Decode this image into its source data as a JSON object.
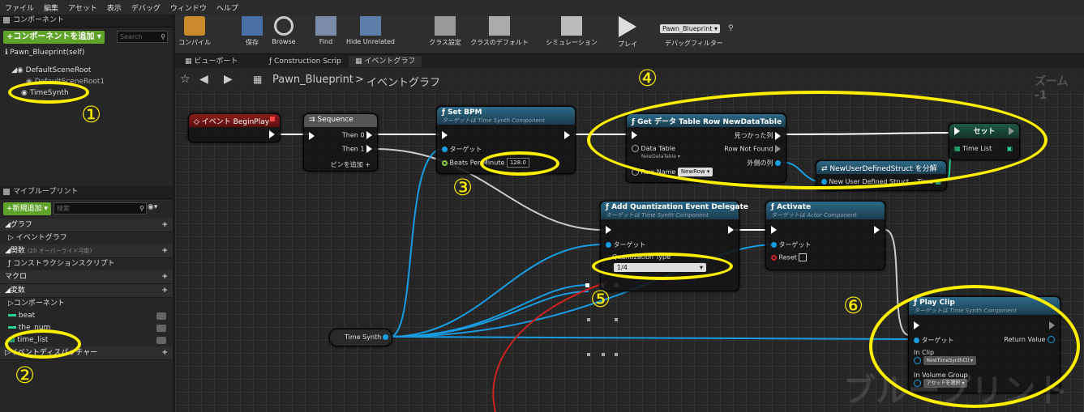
{
  "menu": [
    "ファイル",
    "編集",
    "アセット",
    "表示",
    "デバッグ",
    "ウィンドウ",
    "ヘルプ"
  ],
  "components_panel": {
    "title": "コンポーネント",
    "add_button": "+コンポーネントを追加 ▾",
    "search_placeholder": "Search",
    "self_label": "Pawn_Blueprint(self)",
    "tree": [
      "DefaultSceneRoot",
      "DefaultSceneRoot1",
      "TimeSynth"
    ]
  },
  "mybp_panel": {
    "title": "マイブループリント",
    "add_button": "+新規追加 ▾",
    "search_placeholder": "検索",
    "categories": [
      {
        "label": "グラフ"
      },
      {
        "label": "イベントグラフ",
        "sub": true
      },
      {
        "label": "関数",
        "note": "(20 オーバーライド可能)"
      },
      {
        "label": "コンストラクションスクリプト",
        "sub": true
      },
      {
        "label": "マクロ"
      },
      {
        "label": "変数"
      },
      {
        "label": "コンポーネント",
        "sub": true
      }
    ],
    "variables": [
      "beat",
      "the_num",
      "time_list"
    ],
    "dispatcher_label": "イベントディスパッチャー"
  },
  "toolbar": {
    "buttons": [
      "コンパイル",
      "保存",
      "Browse",
      "Find",
      "Hide Unrelated",
      "クラス設定",
      "クラスのデフォルト",
      "シミュレーション",
      "プレイ"
    ],
    "debug_select": "Pawn_Blueprint ▾",
    "debug_filter_label": "デバッグフィルター"
  },
  "tabs": [
    "ビューポート",
    "Construction Scrip",
    "イベントグラフ"
  ],
  "breadcrumb": {
    "root": "Pawn_Blueprint",
    "sep": ">",
    "page": "イベントグラフ",
    "zoom": "ズーム -1"
  },
  "watermark": "ブループリント",
  "nodes": {
    "beginplay": {
      "title": "イベント BeginPlay"
    },
    "sequence": {
      "title": "Sequence",
      "then0": "Then 0",
      "then1": "Then 1",
      "add_pin": "ピンを追加 +"
    },
    "setbpm": {
      "title": "Set BPM",
      "subtitle": "ターゲットは Time Synth Component",
      "target": "ターゲット",
      "bpm_label": "Beats Per Minute",
      "bpm_value": "128.0"
    },
    "getrow": {
      "title": "Get データ Table Row NewDataTable",
      "found": "見つかった列",
      "notfound": "Row Not Found",
      "outrow": "外側の列",
      "datatable_label": "Data Table",
      "datatable_value": "NewDataTable ▾",
      "rowname_label": "Row Name",
      "rowname_value": "NewRow ▾"
    },
    "break": {
      "title": "NewUserDefinedStruct を分解",
      "input": "New User Defined Struct",
      "out": "Time"
    },
    "set": {
      "title": "セット",
      "pin": "Time List"
    },
    "addq": {
      "title": "Add Quantization Event Delegate",
      "subtitle": "ターゲットは Time Synth Component",
      "target": "ターゲット",
      "qtype_label": "Quantization Type",
      "qtype_value": "1/4"
    },
    "activate": {
      "title": "Activate",
      "subtitle": "ターゲットは Actor Component",
      "target": "ターゲット",
      "reset": "Reset"
    },
    "timesynth": {
      "label": "Time Synth"
    },
    "playclip": {
      "title": "Play Clip",
      "subtitle": "ターゲットは Time Synth Component",
      "target": "ターゲット",
      "return": "Return Value",
      "inclip_label": "In Clip",
      "inclip_value": "NewTimeSynthCli ▾",
      "invol_label": "In Volume Group",
      "invol_value": "アセットを選択 ▾"
    }
  },
  "annotations": [
    "①",
    "②",
    "③",
    "④",
    "⑤",
    "⑥"
  ],
  "colors": {
    "annotation": "#ffee00",
    "exec_wire": "#ffffff",
    "target_wire": "#1a9ce0",
    "event_header": "#8a1c1c",
    "func_header": "#1f4a63",
    "add_green": "#5fa32a"
  }
}
